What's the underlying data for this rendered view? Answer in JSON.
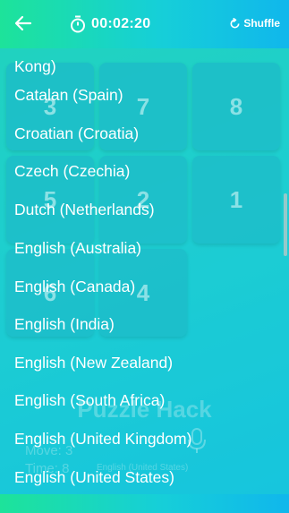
{
  "header": {
    "timer": "00:02:20",
    "shuffle_label": "Shuffle"
  },
  "board": {
    "tiles": [
      "3",
      "7",
      "8",
      "5",
      "2",
      "1",
      "6",
      "4"
    ]
  },
  "background": {
    "brand": "Puzzle Hack",
    "move_label": "Move: 3",
    "time_label": "Time: 8",
    "language_note": "English (United States)"
  },
  "language_menu": {
    "items": [
      "Kong)",
      "Catalan (Spain)",
      "Croatian (Croatia)",
      "Czech (Czechia)",
      "Dutch (Netherlands)",
      "English (Australia)",
      "English (Canada)",
      "English (India)",
      "English (New Zealand)",
      "English (South Africa)",
      "English (United Kingdom)",
      "English (United States)"
    ]
  },
  "colors": {
    "accent_start": "#1de39a",
    "accent_end": "#10b7ec",
    "text": "#ffffff"
  }
}
